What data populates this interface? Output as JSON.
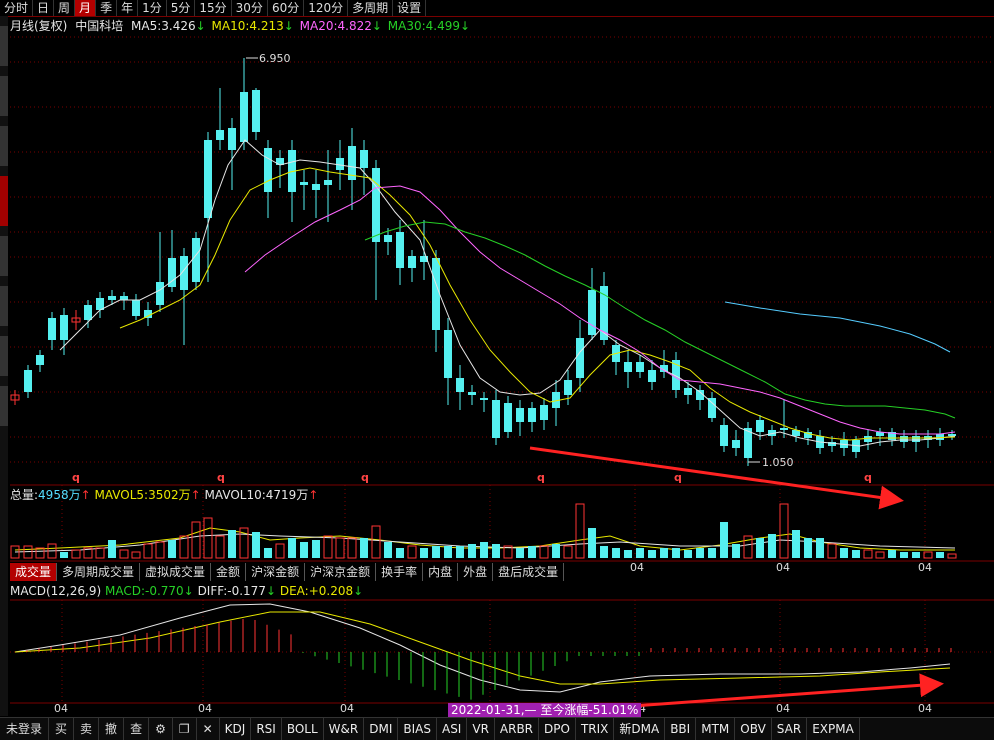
{
  "toolbar": {
    "tabs": [
      "分时",
      "日",
      "周",
      "月",
      "季",
      "年",
      "1分",
      "5分",
      "15分",
      "30分",
      "60分",
      "120分",
      "多周期",
      "设置"
    ],
    "active": "月"
  },
  "price_panel": {
    "period": "月线(复权)",
    "stock_name": "中国科培",
    "ma5": {
      "label": "MA5:",
      "value": "3.426",
      "arrow": "↓"
    },
    "ma10": {
      "label": "MA10:",
      "value": "4.213",
      "arrow": "↓"
    },
    "ma20": {
      "label": "MA20:",
      "value": "4.822",
      "arrow": "↓"
    },
    "ma30": {
      "label": "MA30:",
      "value": "4.499",
      "arrow": "↓"
    },
    "high_label": "6.950",
    "low_label": "1.050",
    "marker_char": "q"
  },
  "volume_panel": {
    "total_label": "总量:",
    "total_value": "4958万",
    "total_arrow": "↑",
    "mavol5_label": "MAVOL5:",
    "mavol5_value": "3502万",
    "mavol5_arrow": "↑",
    "mavol10_label": "MAVOL10:",
    "mavol10_value": "4719万",
    "mavol10_arrow": "↑"
  },
  "mid_tabs": {
    "tabs": [
      "成交量",
      "多周期成交量",
      "虚拟成交量",
      "金额",
      "沪深金额",
      "沪深京金额",
      "换手率",
      "内盘",
      "外盘",
      "盘后成交量"
    ],
    "active": "成交量"
  },
  "macd_panel": {
    "title": "MACD(12,26,9)",
    "macd_label": "MACD:",
    "macd_value": "-0.770",
    "macd_arrow": "↓",
    "diff_label": "DIFF:",
    "diff_value": "-0.177",
    "diff_arrow": "↓",
    "dea_label": "DEA:",
    "dea_value": "+0.208",
    "dea_arrow": "↓"
  },
  "x_axis": {
    "tick_label": "04"
  },
  "range_tooltip": "2022-01-31,— 至今涨幅-51.01%",
  "bottom_bar": {
    "buttons": [
      "未登录",
      "买",
      "卖",
      "撤",
      "查"
    ],
    "icons": [
      "gear-icon",
      "window-icon",
      "close-icon"
    ],
    "indicators": [
      "KDJ",
      "RSI",
      "BOLL",
      "W&R",
      "DMI",
      "BIAS",
      "ASI",
      "VR",
      "ARBR",
      "DPO",
      "TRIX",
      "新DMA",
      "BBI",
      "MTM",
      "OBV",
      "SAR",
      "EXPMA"
    ]
  },
  "colors": {
    "up": "#ff3333",
    "down": "#55f0f0",
    "ma5": "#e6e6e6",
    "ma10": "#e8e800",
    "ma20": "#ff66ff",
    "ma30": "#26d026",
    "accent": "#b30000",
    "grid": "#7a0000",
    "annotation_arrow": "#ff2222"
  }
}
